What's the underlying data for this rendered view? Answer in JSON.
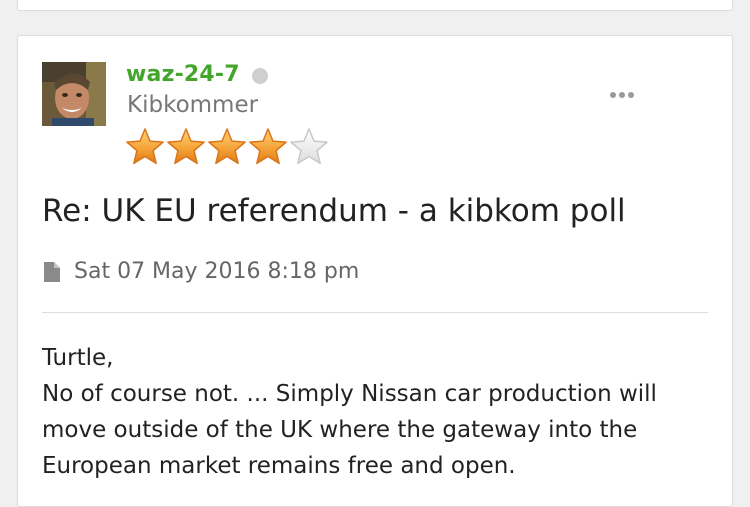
{
  "post": {
    "author": {
      "username": "waz-24-7",
      "rank": "Kibkommer",
      "rating": 4,
      "rating_max": 5,
      "status_color": "#cfcfcf",
      "username_color": "#43a52c"
    },
    "title": "Re: UK EU referendum - a kibkom poll",
    "date": "Sat 07 May 2016 8:18 pm",
    "body_lines": [
      "Turtle,",
      "No of course not. ... Simply Nissan car production will",
      "move outside of the UK where the gateway into the",
      "European market remains free and open."
    ],
    "icons": {
      "more": "more-options-icon",
      "date": "document-icon",
      "status": "online-status-icon"
    }
  }
}
